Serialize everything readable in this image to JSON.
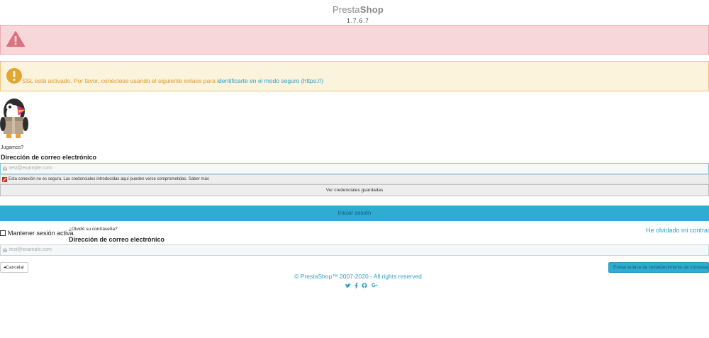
{
  "header": {
    "brand_light": "Presta",
    "brand_bold": "Shop",
    "version": "1.7.6.7"
  },
  "alerts": {
    "danger_icon": "warning-triangle-icon",
    "warning_icon": "exclamation-circle-icon",
    "warning_text": "SSL está activado. Por favor, conéctese usando el siguiente enlace para ",
    "warning_link": "identificarte en el modo seguro (https://)"
  },
  "login": {
    "mascot_caption": "Jugamos?",
    "email_label": "Dirección de correo electrónico",
    "email_placeholder": "test@example.com",
    "insecure_warning": "Esta conexión no es segura. Las credenciales introducidas aquí pueden verse comprometidas. Saber más",
    "saved_credentials_label": "Ver credenciales guardadas",
    "submit_label": "Iniciar sesión",
    "remember_label": "Mantener sesión activa",
    "forgot_link": "He olvidado mi contraseña"
  },
  "forgot": {
    "question": "¿Olvidó su contraseña?",
    "email_label": "Dirección de correo electrónico",
    "email_placeholder": "test@example.com",
    "cancel_label": "Cancelar",
    "send_label": "Enviar enlace de restablecimiento de contraseña"
  },
  "footer": {
    "copyright": "© PrestaShop™ 2007-2020 - All rights reserved",
    "social_icons": [
      "twitter-icon",
      "facebook-icon",
      "github-icon",
      "google-plus-icon"
    ]
  },
  "colors": {
    "accent": "#2eacd1",
    "danger_bg": "#f8d7da",
    "warning_bg": "#fcf3dc",
    "warning_text": "#d99a2b"
  }
}
